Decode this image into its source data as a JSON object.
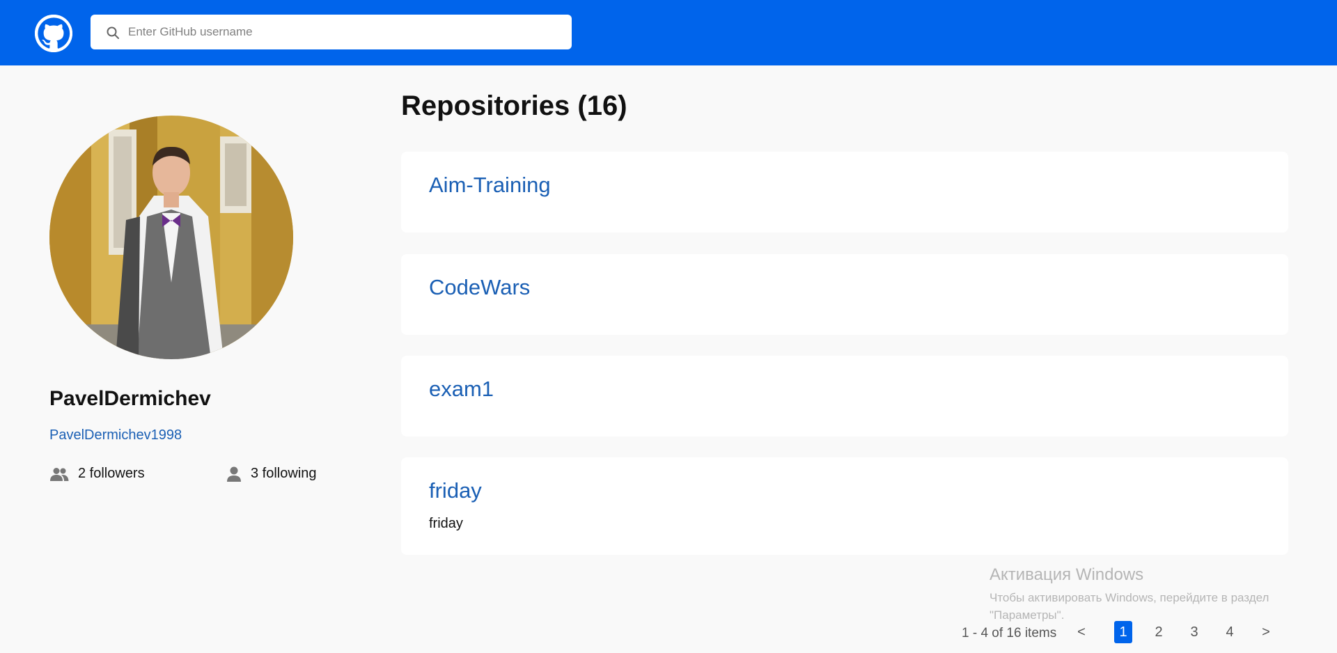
{
  "header": {
    "logo_icon": "github-icon",
    "search_icon": "search-icon",
    "search_placeholder": "Enter GitHub username",
    "accent_color": "#0064eb"
  },
  "profile": {
    "avatar": "profile-photo",
    "name": "PavelDermichev",
    "login": "PavelDermichev1998",
    "followers_text": "2 followers",
    "following_text": "3 following",
    "followers_icon": "people-icon",
    "following_icon": "person-icon"
  },
  "repositories": {
    "title": "Repositories (16)",
    "items": [
      {
        "name": "Aim-Training",
        "description": ""
      },
      {
        "name": "CodeWars",
        "description": ""
      },
      {
        "name": "exam1",
        "description": ""
      },
      {
        "name": "friday",
        "description": "friday"
      }
    ]
  },
  "pagination": {
    "info": "1 - 4 of 16 items",
    "prev": "<",
    "next": ">",
    "pages": [
      "1",
      "2",
      "3",
      "4"
    ],
    "current": "1"
  },
  "watermark": {
    "title": "Активация Windows",
    "text": "Чтобы активировать Windows, перейдите в раздел \"Параметры\"."
  }
}
